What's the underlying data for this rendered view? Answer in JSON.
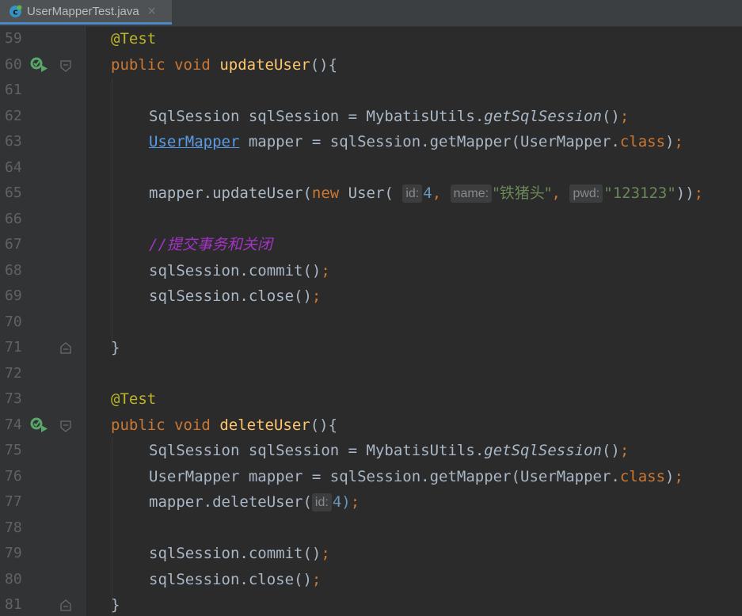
{
  "tab": {
    "filename": "UserMapperTest.java",
    "close": "×"
  },
  "lines": [
    {
      "n": "59"
    },
    {
      "n": "60"
    },
    {
      "n": "61"
    },
    {
      "n": "62"
    },
    {
      "n": "63"
    },
    {
      "n": "64"
    },
    {
      "n": "65"
    },
    {
      "n": "66"
    },
    {
      "n": "67"
    },
    {
      "n": "68"
    },
    {
      "n": "69"
    },
    {
      "n": "70"
    },
    {
      "n": "71"
    },
    {
      "n": "72"
    },
    {
      "n": "73"
    },
    {
      "n": "74"
    },
    {
      "n": "75"
    },
    {
      "n": "76"
    },
    {
      "n": "77"
    },
    {
      "n": "78"
    },
    {
      "n": "79"
    },
    {
      "n": "80"
    },
    {
      "n": "81"
    }
  ],
  "code": {
    "at_test": "@Test",
    "public": "public",
    "void": "void",
    "update_fn": "updateUser",
    "delete_fn": "deleteUser",
    "parens_open": "(){",
    "close_brace": "}",
    "sqlsession_type": "SqlSession",
    "sqlsession_var": " sqlSession = ",
    "mybatis_utils": "MybatisUtils.",
    "get_sql_session": "getSqlSession",
    "call_end": "()",
    "semicolon": ";",
    "user_mapper_type": "UserMapper",
    "mapper_assign": " mapper = sqlSession.getMapper(UserMapper.",
    "class_kw": "class",
    "close_paren_semi": ")",
    "mapper_update": "mapper.updateUser(",
    "new_kw": "new",
    "user_ctor": " User(",
    "hint_id": "id:",
    "val_4": "4",
    "comma": ",",
    "hint_name": "name:",
    "str_name": "\"铁猪头\"",
    "hint_pwd": "pwd:",
    "str_pwd": "\"123123\"",
    "close_double": "))",
    "comment_slashes": "//",
    "comment_text": "提交事务和关闭",
    "commit_call": "sqlSession.commit()",
    "close_call": "sqlSession.close()",
    "mapper_delete": "mapper.deleteUser(",
    "val_4_close": "4)"
  },
  "colors": {
    "background": "#2b2b2b",
    "keyword": "#cc7832",
    "annotation": "#bbb529",
    "method": "#ffc66d",
    "string": "#6a8759",
    "number": "#6897bb",
    "comment": "#a434c5",
    "run_icon": "#59a869"
  },
  "icons": {
    "tab_icon": "java-class-icon",
    "run": "run-test-icon",
    "fold": "fold-marker-icon"
  }
}
